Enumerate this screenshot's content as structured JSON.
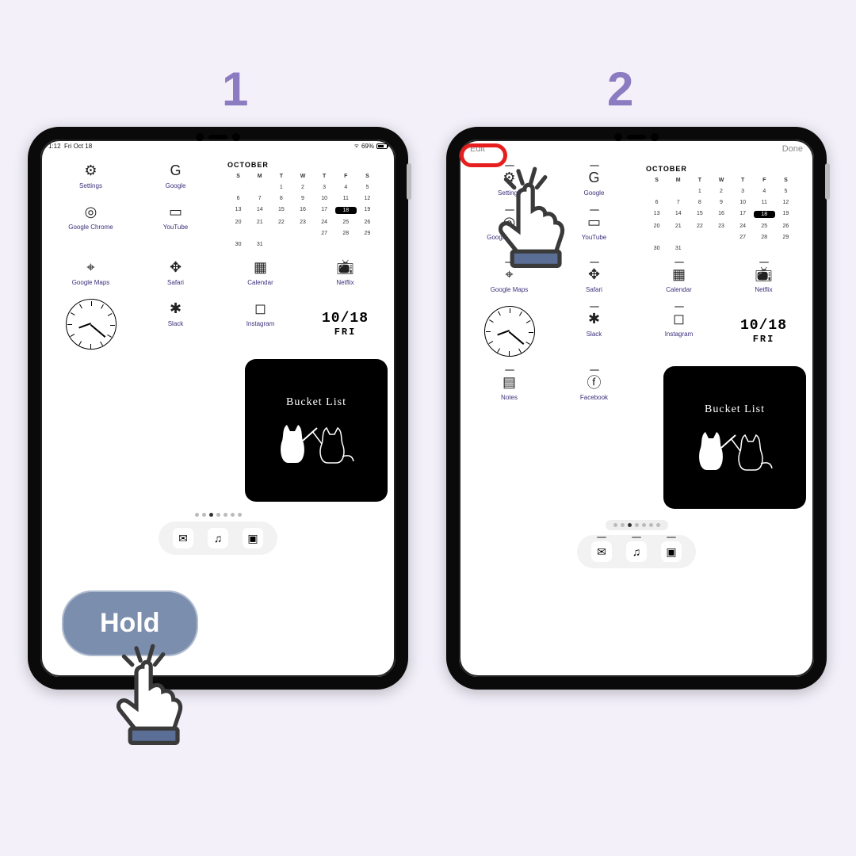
{
  "steps": {
    "one": "1",
    "two": "2"
  },
  "status": {
    "time": "1:12",
    "date": "Fri Oct 18",
    "battery": "69%"
  },
  "edit": {
    "edit": "Edit",
    "done": "Done"
  },
  "apps_r1": [
    {
      "label": "Settings"
    },
    {
      "label": "Google"
    }
  ],
  "apps_r2": [
    {
      "label": "Google Chrome"
    },
    {
      "label": "YouTube"
    }
  ],
  "apps_r3": [
    {
      "label": "Google Maps"
    },
    {
      "label": "Safari"
    },
    {
      "label": "Calendar"
    },
    {
      "label": "Netflix"
    }
  ],
  "apps_r4": [
    {
      "label": "Slack"
    },
    {
      "label": "Instagram"
    }
  ],
  "apps_r5": [
    {
      "label": "Notes"
    },
    {
      "label": "Facebook"
    }
  ],
  "calendar": {
    "title": "OCTOBER",
    "days": [
      "S",
      "M",
      "T",
      "W",
      "T",
      "F",
      "S"
    ],
    "cells": [
      "",
      "",
      "1",
      "2",
      "3",
      "4",
      "5",
      "6",
      "7",
      "8",
      "9",
      "10",
      "11",
      "12",
      "13",
      "14",
      "15",
      "16",
      "17",
      "18",
      "19",
      "20",
      "21",
      "22",
      "23",
      "24",
      "25",
      "26",
      "",
      "",
      "",
      "",
      "27",
      "28",
      "29",
      "30",
      "31",
      "",
      "",
      ""
    ],
    "today": "18"
  },
  "date_widget": {
    "date": "10/18",
    "dow": "FRI"
  },
  "bucket": {
    "title": "Bucket List"
  },
  "overlay": {
    "hold": "Hold"
  }
}
